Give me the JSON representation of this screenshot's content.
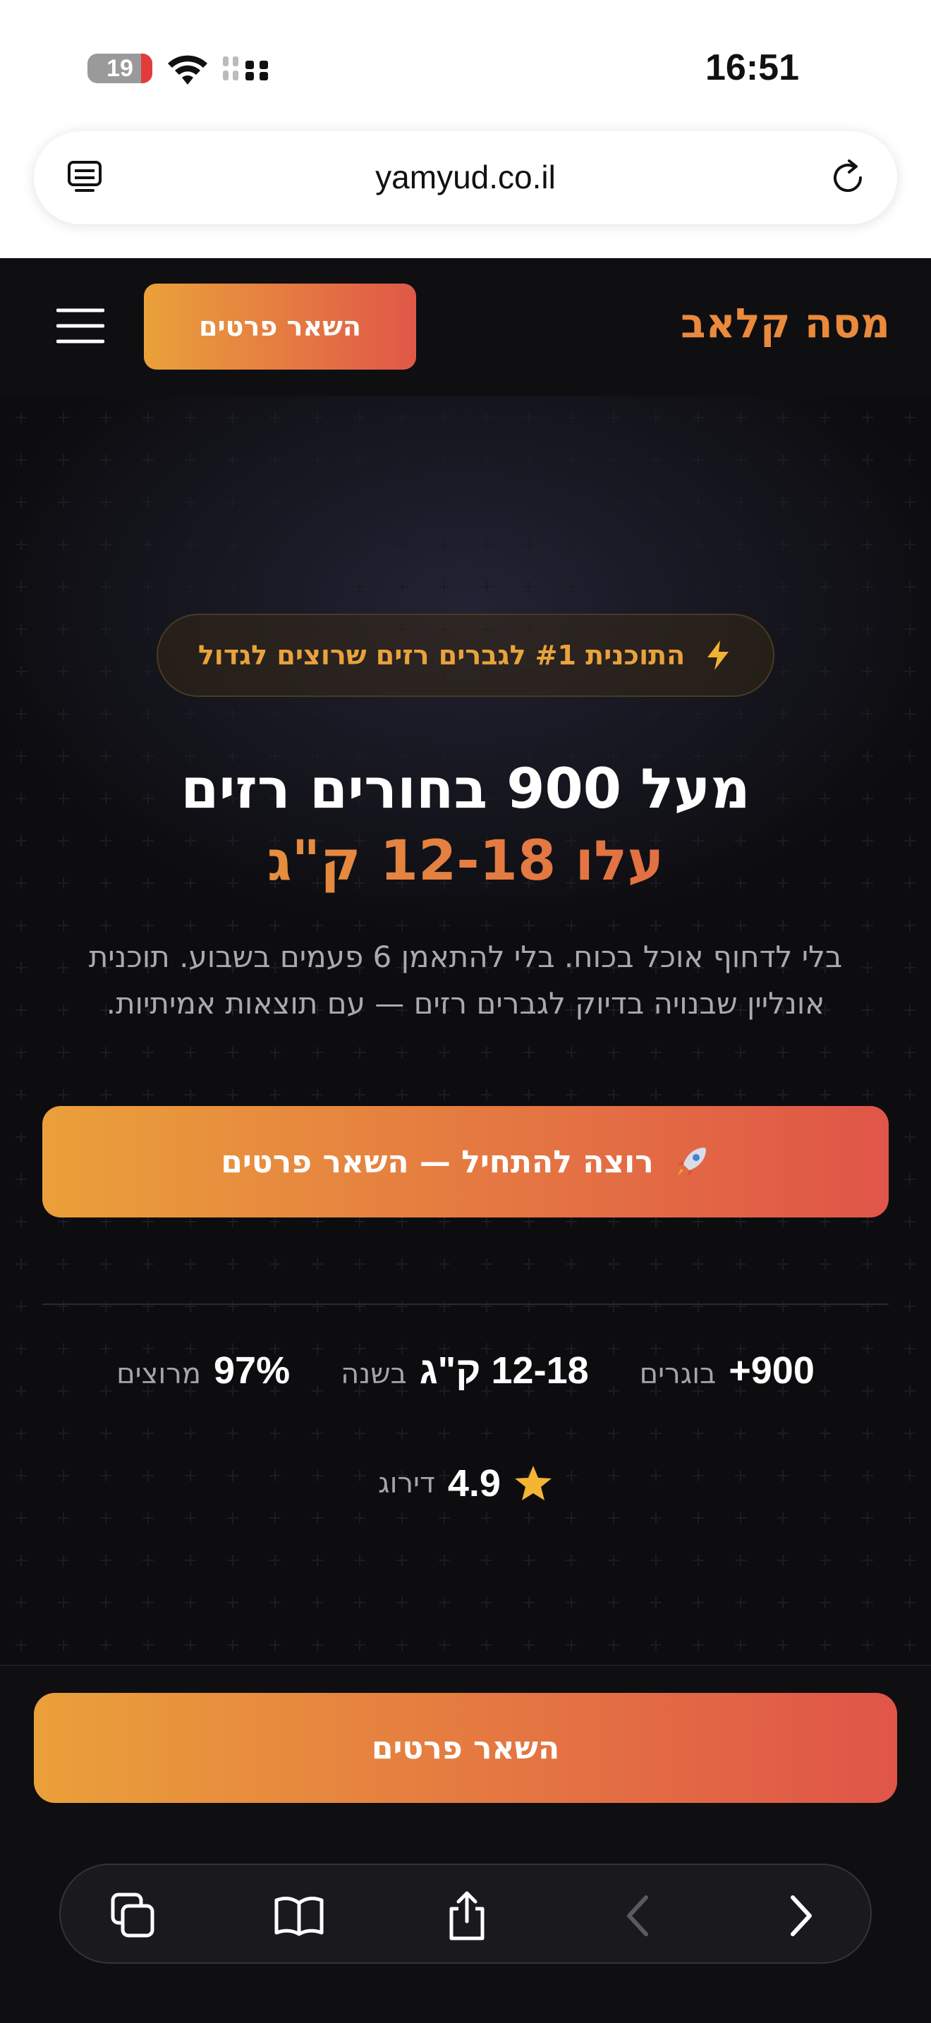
{
  "status_bar": {
    "time": "16:51",
    "battery": "19"
  },
  "browser": {
    "url": "yamyud.co.il"
  },
  "header": {
    "logo": "מסה קלאב",
    "cta_label": "השאר פרטים"
  },
  "hero": {
    "badge": "התוכנית #1 לגברים רזים שרוצים לגדול",
    "title_line1": "מעל 900 בחורים רזים",
    "title_line2": "עלו 12-18 ק\"ג",
    "subtitle": "בלי לדחוף אוכל בכוח. בלי להתאמן 6 פעמים בשבוע. תוכנית אונליין שבנויה בדיוק לגברים רזים — עם תוצאות אמיתיות.",
    "cta_label": "רוצה להתחיל — השאר פרטים"
  },
  "stats": [
    {
      "value": "+900",
      "label": "בוגרים"
    },
    {
      "value": "12-18 ק\"ג",
      "label": "בשנה"
    },
    {
      "value": "97%",
      "label": "מרוצים"
    }
  ],
  "rating": {
    "value": "4.9",
    "label": "דירוג"
  },
  "sticky": {
    "cta_label": "השאר פרטים"
  },
  "colors": {
    "accent_start": "#eaa03a",
    "accent_end": "#e05548",
    "background": "#0d0d10"
  }
}
